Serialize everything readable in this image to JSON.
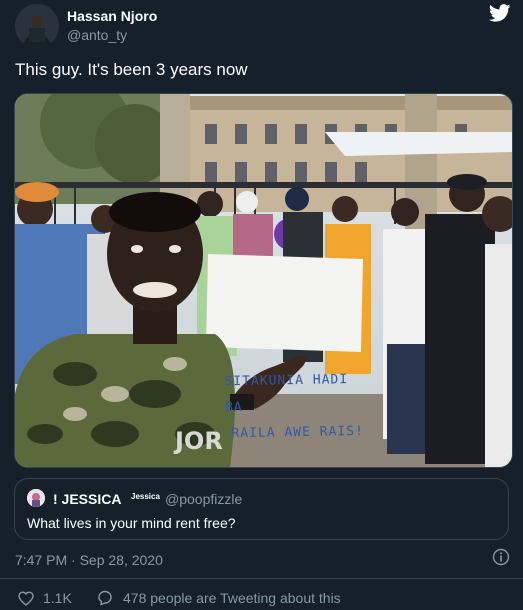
{
  "tweet": {
    "author_name": "Hassan Njoro",
    "author_handle": "@anto_ty",
    "text": "This guy. It's been 3 years now",
    "photo_sign_lines": [
      "SITAKUNIA HADI BA",
      "RAILA AWE RAIS!"
    ],
    "timestamp": "7:47 PM · Sep 28, 2020"
  },
  "quoted": {
    "name": "! JESSICA",
    "badge": "Jessica",
    "handle": "@poopfizzle",
    "text": "What lives in your mind rent free?"
  },
  "stats": {
    "likes": "1.1K",
    "tweeting": "478 people are Tweeting about this"
  },
  "icons": {
    "logo": "twitter-bird-icon",
    "info": "info-icon",
    "like": "heart-icon",
    "reply": "speech-bubble-icon"
  },
  "colors": {
    "background": "#15202b",
    "secondary_text": "#8899a6",
    "border": "#38444d",
    "twitter_blue": "#ffffff"
  }
}
